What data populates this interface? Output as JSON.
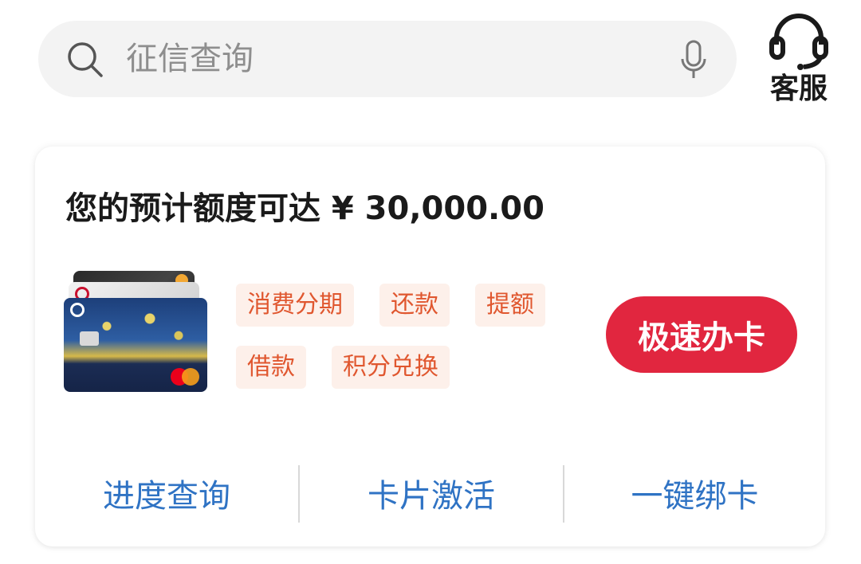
{
  "search": {
    "placeholder": "征信查询"
  },
  "service": {
    "label": "客服"
  },
  "card": {
    "limit_title": "您的预计额度可达 ¥ 30,000.00",
    "tags": [
      "消费分期",
      "还款",
      "提额",
      "借款",
      "积分兑换"
    ],
    "apply_label": "极速办卡",
    "links": [
      "进度查询",
      "卡片激活",
      "一键绑卡"
    ]
  },
  "colors": {
    "accent_red": "#e1263f",
    "tag_text": "#e0572f",
    "tag_bg": "#fdf0ea",
    "link_blue": "#2f73c4"
  },
  "icons": [
    "search-icon",
    "mic-icon",
    "headset-icon"
  ]
}
